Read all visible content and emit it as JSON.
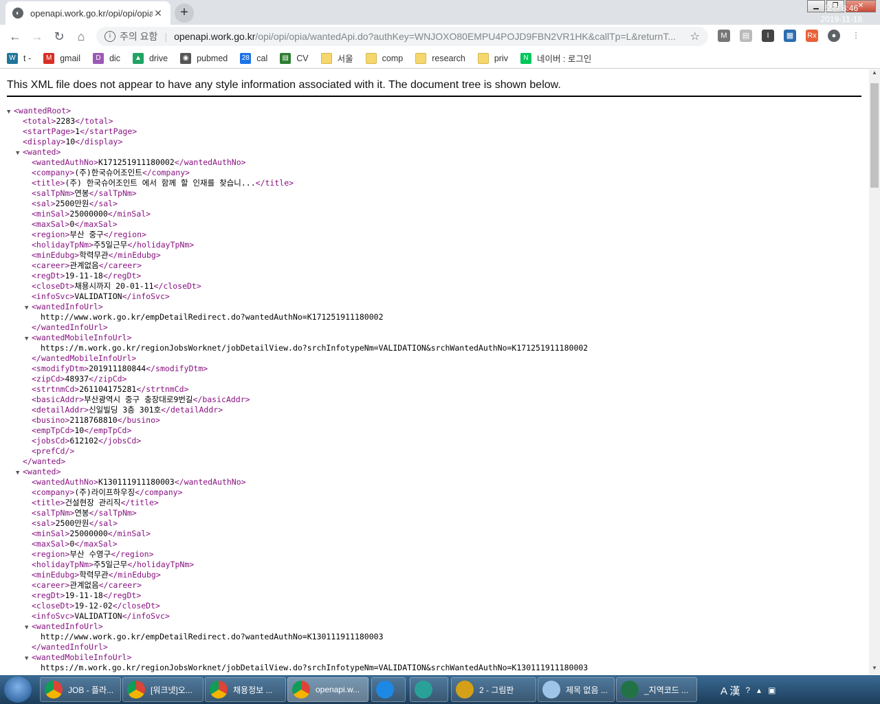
{
  "browser": {
    "tab_title": "openapi.work.go.kr/opi/opi/opia",
    "new_tab": "+",
    "security_label": "주의 요함",
    "url_host": "openapi.work.go.kr",
    "url_path": "/opi/opi/opia/wantedApi.do?authKey=WNJOXO80EMPU4POJD9FBN2VR1HK&callTp=L&returnT..."
  },
  "bookmarks": [
    {
      "label": "t -",
      "icon": "wordpress-icon"
    },
    {
      "label": "gmail",
      "icon": "gmail-icon"
    },
    {
      "label": "dic",
      "icon": "dic-icon"
    },
    {
      "label": "drive",
      "icon": "drive-icon"
    },
    {
      "label": "pubmed",
      "icon": "pubmed-icon"
    },
    {
      "label": "cal",
      "icon": "calendar-icon"
    },
    {
      "label": "CV",
      "icon": "cv-icon"
    },
    {
      "label": "서울",
      "icon": "folder-icon"
    },
    {
      "label": "comp",
      "icon": "folder-icon"
    },
    {
      "label": "research",
      "icon": "folder-icon"
    },
    {
      "label": "priv",
      "icon": "folder-icon"
    },
    {
      "label": "네이버 : 로그인",
      "icon": "naver-icon"
    }
  ],
  "page": {
    "notice": "This XML file does not appear to have any style information associated with it. The document tree is shown below."
  },
  "xml_lines": [
    {
      "i": 0,
      "t": 1,
      "o": "<wantedRoot>",
      "v": "",
      "c": ""
    },
    {
      "i": 1,
      "t": 0,
      "o": "<total>",
      "v": "2283",
      "c": "</total>"
    },
    {
      "i": 1,
      "t": 0,
      "o": "<startPage>",
      "v": "1",
      "c": "</startPage>"
    },
    {
      "i": 1,
      "t": 0,
      "o": "<display>",
      "v": "10",
      "c": "</display>"
    },
    {
      "i": 1,
      "t": 1,
      "o": "<wanted>",
      "v": "",
      "c": ""
    },
    {
      "i": 2,
      "t": 0,
      "o": "<wantedAuthNo>",
      "v": "K171251911180002",
      "c": "</wantedAuthNo>"
    },
    {
      "i": 2,
      "t": 0,
      "o": "<company>",
      "v": "(주)한국슈어조인트",
      "c": "</company>"
    },
    {
      "i": 2,
      "t": 0,
      "o": "<title>",
      "v": "(주) 한국슈어조인트 에서 함께 할 인재를 찾습니...",
      "c": "</title>"
    },
    {
      "i": 2,
      "t": 0,
      "o": "<salTpNm>",
      "v": "연봉",
      "c": "</salTpNm>"
    },
    {
      "i": 2,
      "t": 0,
      "o": "<sal>",
      "v": "2500만원",
      "c": "</sal>"
    },
    {
      "i": 2,
      "t": 0,
      "o": "<minSal>",
      "v": "25000000",
      "c": "</minSal>"
    },
    {
      "i": 2,
      "t": 0,
      "o": "<maxSal>",
      "v": "0",
      "c": "</maxSal>"
    },
    {
      "i": 2,
      "t": 0,
      "o": "<region>",
      "v": "부산 중구",
      "c": "</region>"
    },
    {
      "i": 2,
      "t": 0,
      "o": "<holidayTpNm>",
      "v": "주5일근무",
      "c": "</holidayTpNm>"
    },
    {
      "i": 2,
      "t": 0,
      "o": "<minEdubg>",
      "v": "학력무관",
      "c": "</minEdubg>"
    },
    {
      "i": 2,
      "t": 0,
      "o": "<career>",
      "v": "관계없음",
      "c": "</career>"
    },
    {
      "i": 2,
      "t": 0,
      "o": "<regDt>",
      "v": "19-11-18",
      "c": "</regDt>"
    },
    {
      "i": 2,
      "t": 0,
      "o": "<closeDt>",
      "v": "채용시까지 20-01-11",
      "c": "</closeDt>"
    },
    {
      "i": 2,
      "t": 0,
      "o": "<infoSvc>",
      "v": "VALIDATION",
      "c": "</infoSvc>"
    },
    {
      "i": 2,
      "t": 1,
      "o": "<wantedInfoUrl>",
      "v": "",
      "c": ""
    },
    {
      "i": 3,
      "t": 0,
      "o": "",
      "v": "http://www.work.go.kr/empDetailRedirect.do?wantedAuthNo=K171251911180002",
      "c": ""
    },
    {
      "i": 2,
      "t": 0,
      "o": "</wantedInfoUrl>",
      "v": "",
      "c": ""
    },
    {
      "i": 2,
      "t": 1,
      "o": "<wantedMobileInfoUrl>",
      "v": "",
      "c": ""
    },
    {
      "i": 3,
      "t": 0,
      "o": "",
      "v": "https://m.work.go.kr/regionJobsWorknet/jobDetailView.do?srchInfotypeNm=VALIDATION&srchWantedAuthNo=K171251911180002",
      "c": ""
    },
    {
      "i": 2,
      "t": 0,
      "o": "</wantedMobileInfoUrl>",
      "v": "",
      "c": ""
    },
    {
      "i": 2,
      "t": 0,
      "o": "<smodifyDtm>",
      "v": "201911180844",
      "c": "</smodifyDtm>"
    },
    {
      "i": 2,
      "t": 0,
      "o": "<zipCd>",
      "v": "48937",
      "c": "</zipCd>"
    },
    {
      "i": 2,
      "t": 0,
      "o": "<strtnmCd>",
      "v": "261104175281",
      "c": "</strtnmCd>"
    },
    {
      "i": 2,
      "t": 0,
      "o": "<basicAddr>",
      "v": "부산광역시 중구 충장대로9번길",
      "c": "</basicAddr>"
    },
    {
      "i": 2,
      "t": 0,
      "o": "<detailAddr>",
      "v": "신일빌딩 3층 301호",
      "c": "</detailAddr>"
    },
    {
      "i": 2,
      "t": 0,
      "o": "<busino>",
      "v": "2118768810",
      "c": "</busino>"
    },
    {
      "i": 2,
      "t": 0,
      "o": "<empTpCd>",
      "v": "10",
      "c": "</empTpCd>"
    },
    {
      "i": 2,
      "t": 0,
      "o": "<jobsCd>",
      "v": "612102",
      "c": "</jobsCd>"
    },
    {
      "i": 2,
      "t": 0,
      "o": "<prefCd/>",
      "v": "",
      "c": ""
    },
    {
      "i": 1,
      "t": 0,
      "o": "</wanted>",
      "v": "",
      "c": ""
    },
    {
      "i": 1,
      "t": 1,
      "o": "<wanted>",
      "v": "",
      "c": ""
    },
    {
      "i": 2,
      "t": 0,
      "o": "<wantedAuthNo>",
      "v": "K130111911180003",
      "c": "</wantedAuthNo>"
    },
    {
      "i": 2,
      "t": 0,
      "o": "<company>",
      "v": "(주)라이프하우징",
      "c": "</company>"
    },
    {
      "i": 2,
      "t": 0,
      "o": "<title>",
      "v": "건설현장 관리직",
      "c": "</title>"
    },
    {
      "i": 2,
      "t": 0,
      "o": "<salTpNm>",
      "v": "연봉",
      "c": "</salTpNm>"
    },
    {
      "i": 2,
      "t": 0,
      "o": "<sal>",
      "v": "2500만원",
      "c": "</sal>"
    },
    {
      "i": 2,
      "t": 0,
      "o": "<minSal>",
      "v": "25000000",
      "c": "</minSal>"
    },
    {
      "i": 2,
      "t": 0,
      "o": "<maxSal>",
      "v": "0",
      "c": "</maxSal>"
    },
    {
      "i": 2,
      "t": 0,
      "o": "<region>",
      "v": "부산 수영구",
      "c": "</region>"
    },
    {
      "i": 2,
      "t": 0,
      "o": "<holidayTpNm>",
      "v": "주5일근무",
      "c": "</holidayTpNm>"
    },
    {
      "i": 2,
      "t": 0,
      "o": "<minEdubg>",
      "v": "학력무관",
      "c": "</minEdubg>"
    },
    {
      "i": 2,
      "t": 0,
      "o": "<career>",
      "v": "관계없음",
      "c": "</career>"
    },
    {
      "i": 2,
      "t": 0,
      "o": "<regDt>",
      "v": "19-11-18",
      "c": "</regDt>"
    },
    {
      "i": 2,
      "t": 0,
      "o": "<closeDt>",
      "v": "19-12-02",
      "c": "</closeDt>"
    },
    {
      "i": 2,
      "t": 0,
      "o": "<infoSvc>",
      "v": "VALIDATION",
      "c": "</infoSvc>"
    },
    {
      "i": 2,
      "t": 1,
      "o": "<wantedInfoUrl>",
      "v": "",
      "c": ""
    },
    {
      "i": 3,
      "t": 0,
      "o": "",
      "v": "http://www.work.go.kr/empDetailRedirect.do?wantedAuthNo=K130111911180003",
      "c": ""
    },
    {
      "i": 2,
      "t": 0,
      "o": "</wantedInfoUrl>",
      "v": "",
      "c": ""
    },
    {
      "i": 2,
      "t": 1,
      "o": "<wantedMobileInfoUrl>",
      "v": "",
      "c": ""
    },
    {
      "i": 3,
      "t": 0,
      "o": "",
      "v": "https://m.work.go.kr/regionJobsWorknet/jobDetailView.do?srchInfotypeNm=VALIDATION&srchWantedAuthNo=K130111911180003",
      "c": ""
    }
  ],
  "taskbar": {
    "items": [
      {
        "label": "JOB - 플라...",
        "icon": "chrome-icon"
      },
      {
        "label": "[워크넷]오...",
        "icon": "chrome-icon"
      },
      {
        "label": "채용정보 ...",
        "icon": "chrome-icon"
      },
      {
        "label": "openapi.w...",
        "icon": "chrome-icon"
      },
      {
        "label": "",
        "icon": "ie-icon"
      },
      {
        "label": "",
        "icon": "app-icon"
      },
      {
        "label": "2 - 그림판",
        "icon": "paint-icon"
      },
      {
        "label": "제목 없음 ...",
        "icon": "notepad-icon"
      },
      {
        "label": "_지역코드 ...",
        "icon": "excel-icon"
      }
    ],
    "clock_time": "오전 8:46",
    "clock_date": "2019-11-18",
    "ime": "A 漢"
  },
  "colors": {
    "xml_tag": "#881280",
    "chrome_frame": "#dee1e6"
  }
}
